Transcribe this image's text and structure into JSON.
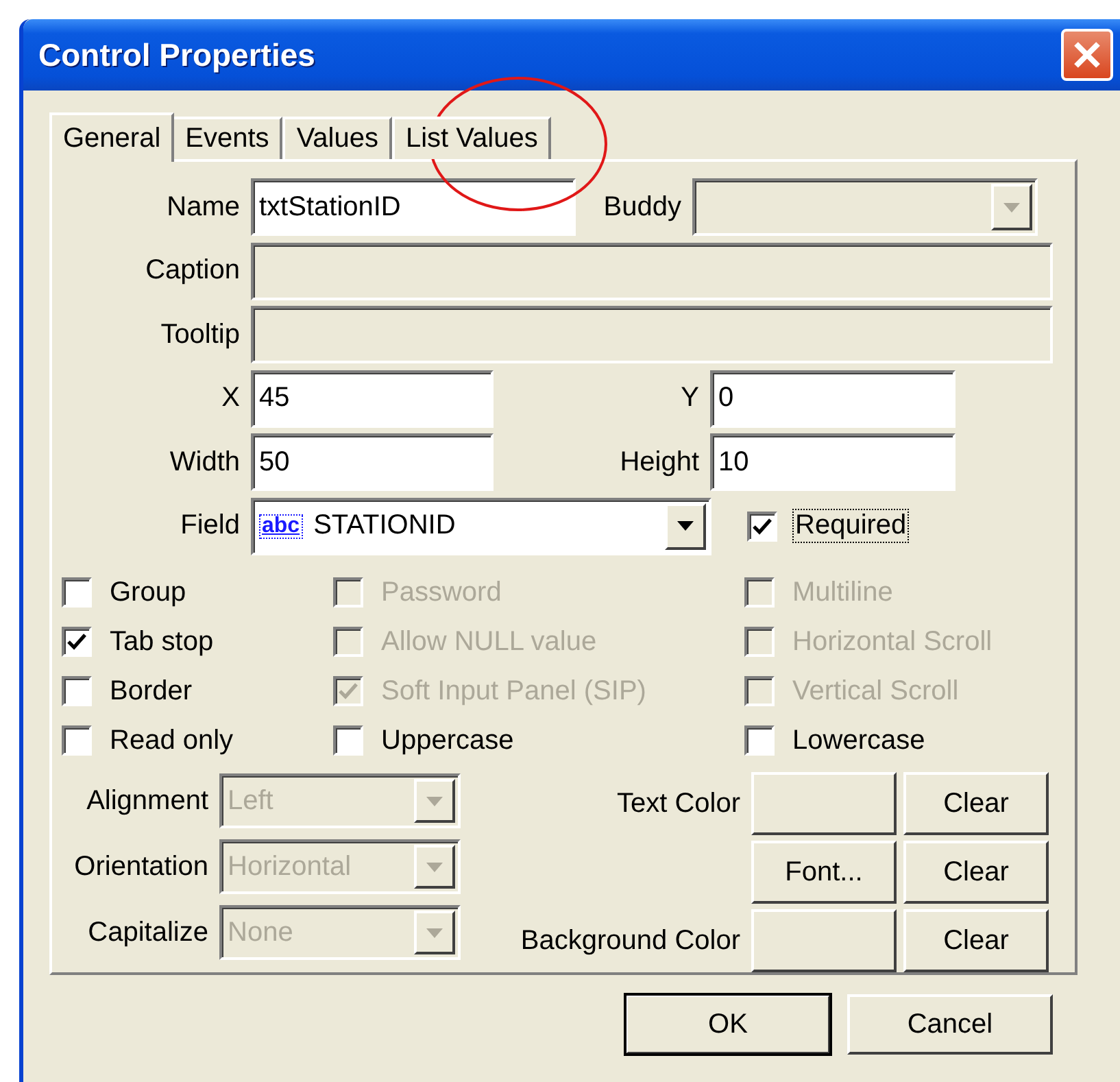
{
  "window": {
    "title": "Control Properties"
  },
  "tabs": [
    {
      "label": "General",
      "selected": true
    },
    {
      "label": "Events",
      "selected": false
    },
    {
      "label": "Values",
      "selected": false
    },
    {
      "label": "List Values",
      "selected": false
    }
  ],
  "name": {
    "label": "Name",
    "value": "txtStationID"
  },
  "buddy": {
    "label": "Buddy",
    "disabled": true
  },
  "caption": {
    "label": "Caption",
    "disabled": true
  },
  "tooltip": {
    "label": "Tooltip",
    "disabled": true
  },
  "x": {
    "label": "X",
    "value": "45"
  },
  "y": {
    "label": "Y",
    "value": "0"
  },
  "width": {
    "label": "Width",
    "value": "50"
  },
  "height": {
    "label": "Height",
    "value": "10"
  },
  "field": {
    "label": "Field",
    "type_badge": "abc",
    "value": "STATIONID"
  },
  "required": {
    "label": "Required",
    "checked": true,
    "focused": true,
    "disabled": false
  },
  "checkboxes": [
    {
      "label": "Group",
      "checked": false,
      "disabled": false
    },
    {
      "label": "Password",
      "checked": false,
      "disabled": true
    },
    {
      "label": "Multiline",
      "checked": false,
      "disabled": true
    },
    {
      "label": "Tab stop",
      "checked": true,
      "disabled": false
    },
    {
      "label": "Allow NULL value",
      "checked": false,
      "disabled": true
    },
    {
      "label": "Horizontal Scroll",
      "checked": false,
      "disabled": true
    },
    {
      "label": "Border",
      "checked": false,
      "disabled": false
    },
    {
      "label": "Soft Input Panel (SIP)",
      "checked": true,
      "disabled": true
    },
    {
      "label": "Vertical Scroll",
      "checked": false,
      "disabled": true
    },
    {
      "label": "Read only",
      "checked": false,
      "disabled": false
    },
    {
      "label": "Uppercase",
      "checked": false,
      "disabled": false
    },
    {
      "label": "Lowercase",
      "checked": false,
      "disabled": false
    }
  ],
  "dropdowns": [
    {
      "label": "Alignment",
      "value": "Left",
      "disabled": true
    },
    {
      "label": "Orientation",
      "value": "Horizontal",
      "disabled": true
    },
    {
      "label": "Capitalize",
      "value": "None",
      "disabled": true
    }
  ],
  "style_rows": [
    {
      "label": "Text Color",
      "button": "",
      "clear": "Clear"
    },
    {
      "label": "",
      "button": "Font...",
      "clear": "Clear"
    },
    {
      "label": "Background Color",
      "button": "",
      "clear": "Clear"
    }
  ],
  "buttons": [
    {
      "label": "OK",
      "default": true
    },
    {
      "label": "Cancel",
      "default": false
    }
  ]
}
